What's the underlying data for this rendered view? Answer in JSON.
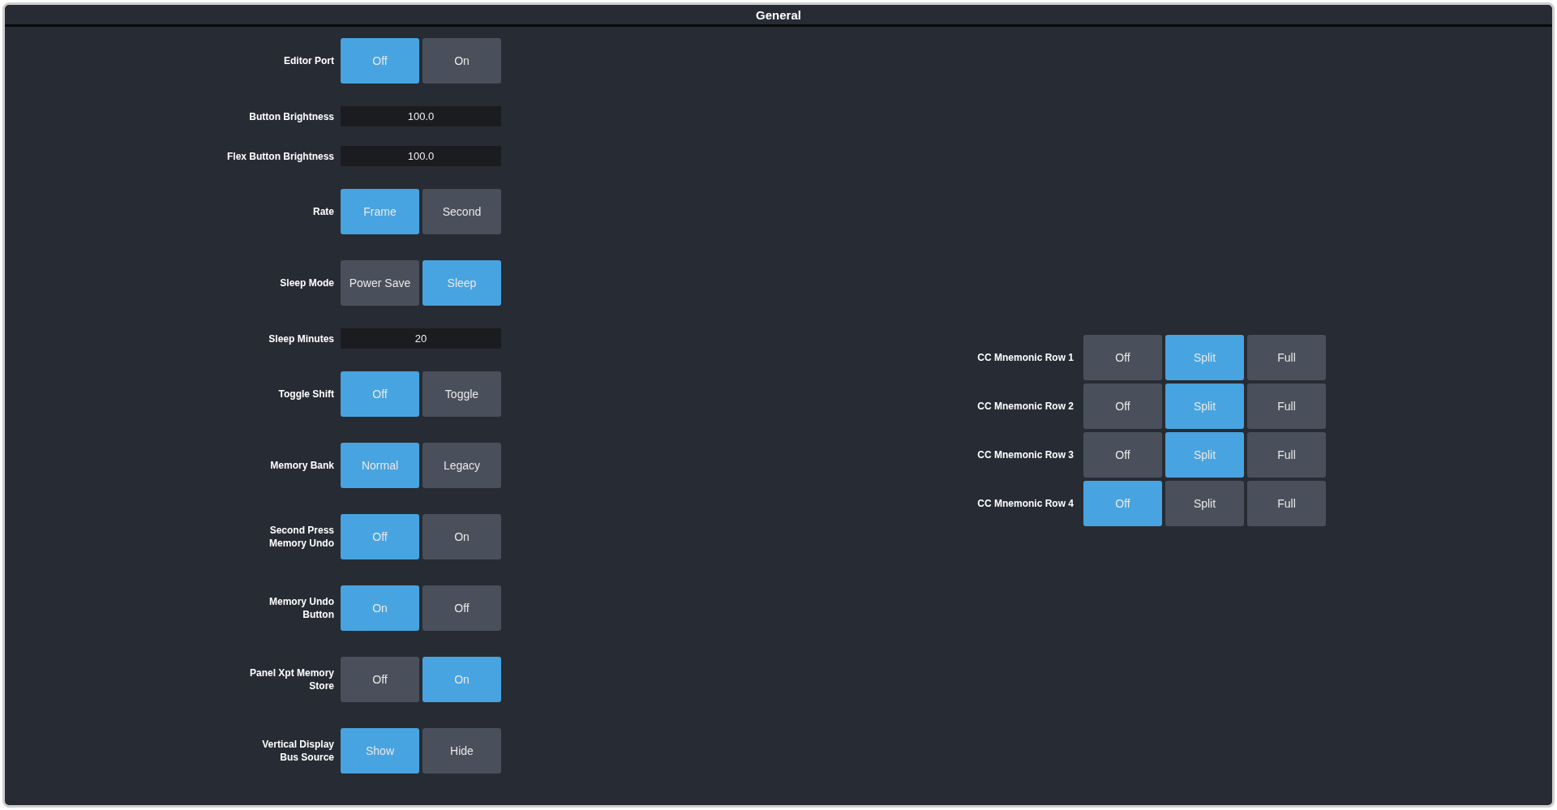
{
  "window": {
    "title": "General"
  },
  "settings": [
    {
      "kind": "toggle",
      "label": "Editor Port",
      "options": [
        {
          "label": "Off",
          "selected": true
        },
        {
          "label": "On",
          "selected": false
        }
      ]
    },
    {
      "kind": "value",
      "label": "Button Brightness",
      "value": "100.0"
    },
    {
      "kind": "value",
      "label": "Flex Button Brightness",
      "value": "100.0"
    },
    {
      "kind": "toggle",
      "label": "Rate",
      "options": [
        {
          "label": "Frame",
          "selected": true
        },
        {
          "label": "Second",
          "selected": false
        }
      ]
    },
    {
      "kind": "toggle",
      "label": "Sleep Mode",
      "options": [
        {
          "label": "Power Save",
          "selected": false
        },
        {
          "label": "Sleep",
          "selected": true
        }
      ]
    },
    {
      "kind": "value",
      "label": "Sleep Minutes",
      "value": "20"
    },
    {
      "kind": "toggle",
      "label": "Toggle Shift",
      "options": [
        {
          "label": "Off",
          "selected": true
        },
        {
          "label": "Toggle",
          "selected": false
        }
      ]
    },
    {
      "kind": "toggle",
      "label": "Memory Bank",
      "options": [
        {
          "label": "Normal",
          "selected": true
        },
        {
          "label": "Legacy",
          "selected": false
        }
      ]
    },
    {
      "kind": "toggle",
      "label": "Second Press Memory Undo",
      "options": [
        {
          "label": "Off",
          "selected": true
        },
        {
          "label": "On",
          "selected": false
        }
      ]
    },
    {
      "kind": "toggle",
      "label": "Memory Undo Button",
      "options": [
        {
          "label": "On",
          "selected": true
        },
        {
          "label": "Off",
          "selected": false
        }
      ]
    },
    {
      "kind": "toggle",
      "label": "Panel Xpt Memory Store",
      "options": [
        {
          "label": "Off",
          "selected": false
        },
        {
          "label": "On",
          "selected": true
        }
      ]
    },
    {
      "kind": "toggle",
      "label": "Vertical Display Bus Source",
      "options": [
        {
          "label": "Show",
          "selected": true
        },
        {
          "label": "Hide",
          "selected": false
        }
      ]
    }
  ],
  "mnemonic_rows": [
    {
      "label": "CC Mnemonic Row 1",
      "options": [
        {
          "label": "Off",
          "selected": false
        },
        {
          "label": "Split",
          "selected": true
        },
        {
          "label": "Full",
          "selected": false
        }
      ]
    },
    {
      "label": "CC Mnemonic Row 2",
      "options": [
        {
          "label": "Off",
          "selected": false
        },
        {
          "label": "Split",
          "selected": true
        },
        {
          "label": "Full",
          "selected": false
        }
      ]
    },
    {
      "label": "CC Mnemonic Row 3",
      "options": [
        {
          "label": "Off",
          "selected": false
        },
        {
          "label": "Split",
          "selected": true
        },
        {
          "label": "Full",
          "selected": false
        }
      ]
    },
    {
      "label": "CC Mnemonic Row 4",
      "options": [
        {
          "label": "Off",
          "selected": true
        },
        {
          "label": "Split",
          "selected": false
        },
        {
          "label": "Full",
          "selected": false
        }
      ]
    }
  ]
}
